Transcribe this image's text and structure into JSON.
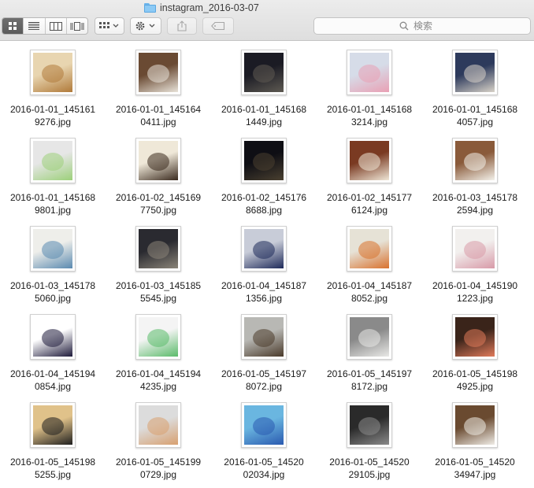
{
  "window": {
    "title": "instagram_2016-03-07",
    "folder_icon": "folder-icon"
  },
  "toolbar": {
    "view_buttons": [
      "icon-view-icon",
      "list-view-icon",
      "column-view-icon",
      "coverflow-view-icon"
    ],
    "search_placeholder": "検索"
  },
  "files": [
    {
      "l1": "2016-01-01_145161",
      "l2": "9276.jpg",
      "c1": "#e8d5b0",
      "c2": "#b07a3a"
    },
    {
      "l1": "2016-01-01_145164",
      "l2": "0411.jpg",
      "c1": "#6a4a33",
      "c2": "#e8e2d8"
    },
    {
      "l1": "2016-01-01_145168",
      "l2": "1449.jpg",
      "c1": "#1b1b24",
      "c2": "#5e5a52"
    },
    {
      "l1": "2016-01-01_145168",
      "l2": "3214.jpg",
      "c1": "#d6dce8",
      "c2": "#e9a0b4"
    },
    {
      "l1": "2016-01-01_145168",
      "l2": "4057.jpg",
      "c1": "#2d3a5c",
      "c2": "#d8d2c8"
    },
    {
      "l1": "2016-01-01_145168",
      "l2": "9801.jpg",
      "c1": "#e6e6e6",
      "c2": "#9cd07a"
    },
    {
      "l1": "2016-01-02_145169",
      "l2": "7750.jpg",
      "c1": "#efe8d8",
      "c2": "#3a2a1e"
    },
    {
      "l1": "2016-01-02_145176",
      "l2": "8688.jpg",
      "c1": "#0e0e14",
      "c2": "#4a4030"
    },
    {
      "l1": "2016-01-02_145177",
      "l2": "6124.jpg",
      "c1": "#7a3a22",
      "c2": "#efe6d6"
    },
    {
      "l1": "2016-01-03_145178",
      "l2": "2594.jpg",
      "c1": "#8a5a3a",
      "c2": "#f3f1ea"
    },
    {
      "l1": "2016-01-03_145178",
      "l2": "5060.jpg",
      "c1": "#eeeeea",
      "c2": "#5a8ab0"
    },
    {
      "l1": "2016-01-03_145185",
      "l2": "5545.jpg",
      "c1": "#2a2a30",
      "c2": "#8a8478"
    },
    {
      "l1": "2016-01-04_145187",
      "l2": "1356.jpg",
      "c1": "#c8ccd8",
      "c2": "#1e2a5a"
    },
    {
      "l1": "2016-01-04_145187",
      "l2": "8052.jpg",
      "c1": "#e6e2d6",
      "c2": "#d9722e"
    },
    {
      "l1": "2016-01-04_145190",
      "l2": "1223.jpg",
      "c1": "#f2f0ee",
      "c2": "#d89aa8"
    },
    {
      "l1": "2016-01-04_145194",
      "l2": "0854.jpg",
      "c1": "#ffffff",
      "c2": "#1e1a3a"
    },
    {
      "l1": "2016-01-04_145194",
      "l2": "4235.jpg",
      "c1": "#f4f4f4",
      "c2": "#5abb6a"
    },
    {
      "l1": "2016-01-05_145197",
      "l2": "8072.jpg",
      "c1": "#b8b8b4",
      "c2": "#4a3a2a"
    },
    {
      "l1": "2016-01-05_145197",
      "l2": "8172.jpg",
      "c1": "#8a8a8a",
      "c2": "#e8e8e6"
    },
    {
      "l1": "2016-01-05_145198",
      "l2": "4925.jpg",
      "c1": "#3a241a",
      "c2": "#e07a5a"
    },
    {
      "l1": "2016-01-05_145198",
      "l2": "5255.jpg",
      "c1": "#e0c28a",
      "c2": "#1e1e1e"
    },
    {
      "l1": "2016-01-05_145199",
      "l2": "0729.jpg",
      "c1": "#dcdcdc",
      "c2": "#d8a070"
    },
    {
      "l1": "2016-01-05_14520",
      "l2": "02034.jpg",
      "c1": "#6ab6e0",
      "c2": "#2a5ab0"
    },
    {
      "l1": "2016-01-05_14520",
      "l2": "29105.jpg",
      "c1": "#2a2a2a",
      "c2": "#8a8a8a"
    },
    {
      "l1": "2016-01-05_14520",
      "l2": "34947.jpg",
      "c1": "#6a4a30",
      "c2": "#efece6"
    }
  ]
}
